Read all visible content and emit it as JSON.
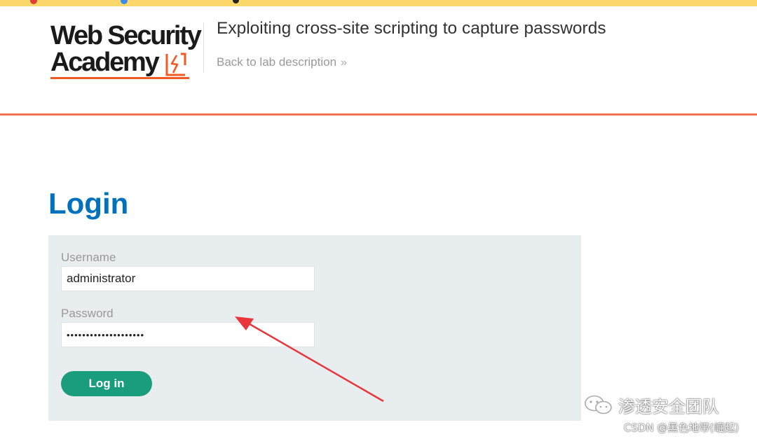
{
  "header": {
    "logo_line1": "Web Security",
    "logo_line2": "Academy",
    "lab_title": "Exploiting cross-site scripting to capture passwords",
    "back_link": "Back to lab description",
    "back_link_chevron": "»"
  },
  "login": {
    "heading": "Login",
    "username_label": "Username",
    "username_value": "administrator",
    "password_label": "Password",
    "password_value": "••••••••••••••••••••",
    "submit_label": "Log in"
  },
  "watermark": {
    "team": "渗透安全团队",
    "csdn": "CSDN @黑色地带(崛起)"
  },
  "colors": {
    "brand_orange": "#f25a23",
    "login_blue": "#0071bc",
    "button_green": "#1a9d7c",
    "panel_gray": "#e8eef0",
    "annotation_red": "#e8363a"
  },
  "icons": [
    "lightning-bolt-icon",
    "double-chevron-right-icon",
    "wechat-icon",
    "annotation-arrow"
  ]
}
